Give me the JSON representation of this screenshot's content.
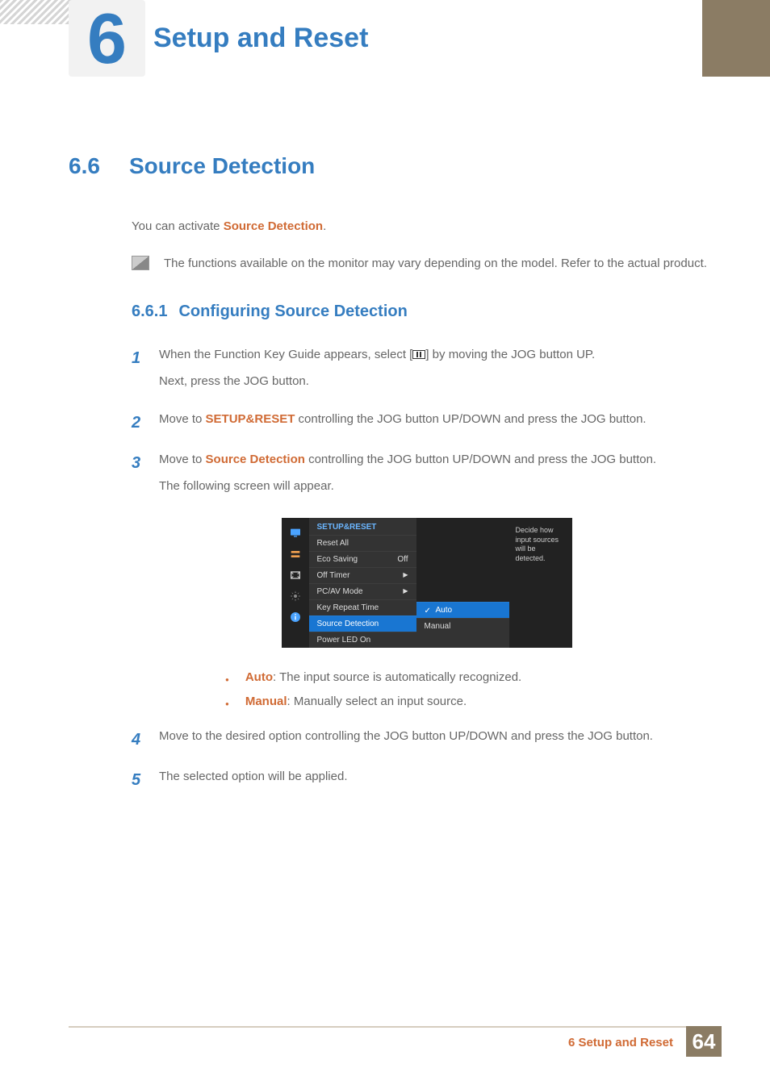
{
  "header": {
    "chapter_num": "6",
    "chapter_title": "Setup and Reset"
  },
  "section": {
    "num": "6.6",
    "title": "Source Detection"
  },
  "intro": {
    "prefix": "You can activate ",
    "kw": "Source Detection",
    "suffix": "."
  },
  "note": "The functions available on the monitor may vary depending on the model. Refer to the actual product.",
  "subsection": {
    "num": "6.6.1",
    "title": "Configuring Source Detection"
  },
  "steps": {
    "s1": {
      "num": "1",
      "a": "When the Function Key Guide appears, select [",
      "b": "] by moving the JOG button UP.",
      "c": "Next, press the JOG button."
    },
    "s2": {
      "num": "2",
      "a": "Move to ",
      "kw": "SETUP&RESET",
      "b": " controlling the JOG button UP/DOWN and press the JOG button."
    },
    "s3": {
      "num": "3",
      "a": "Move to ",
      "kw": "Source Detection",
      "b": " controlling the JOG button UP/DOWN and press the JOG button.",
      "c": "The following screen will appear."
    },
    "s4": {
      "num": "4",
      "a": "Move to the desired option controlling the JOG button UP/DOWN and press the JOG button."
    },
    "s5": {
      "num": "5",
      "a": "The selected option will be applied."
    }
  },
  "osd": {
    "title": "SETUP&RESET",
    "rows": {
      "reset": "Reset All",
      "eco": "Eco Saving",
      "eco_val": "Off",
      "timer": "Off Timer",
      "pcav": "PC/AV Mode",
      "krt": "Key Repeat Time",
      "src": "Source Detection",
      "led": "Power LED On"
    },
    "submenu": {
      "auto": "Auto",
      "manual": "Manual"
    },
    "tip": "Decide how input sources will be detected."
  },
  "bullets": {
    "auto_kw": "Auto",
    "auto_txt": ": The input source is automatically recognized.",
    "manual_kw": "Manual",
    "manual_txt": ": Manually select an input source."
  },
  "footer": {
    "label": "6 Setup and Reset",
    "page": "64"
  }
}
